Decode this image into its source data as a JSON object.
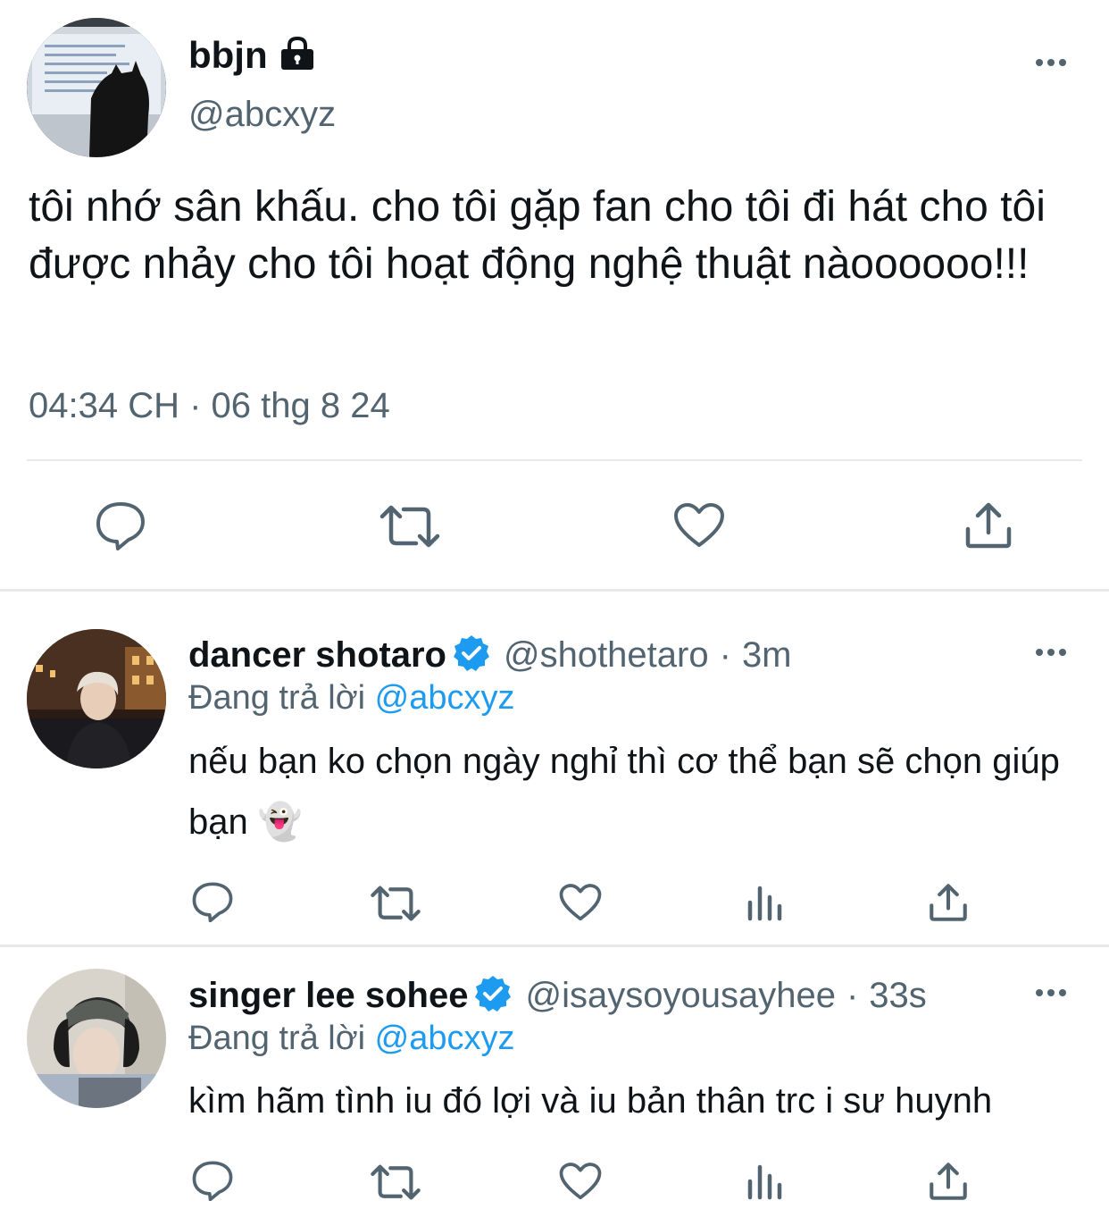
{
  "main_tweet": {
    "author_name": "bbjn",
    "author_handle": "@abcxyz",
    "text": "tôi nhớ sân khấu. cho tôi gặp fan cho tôi đi hát cho tôi được nhảy cho tôi hoạt động nghệ thuật nàoooooo!!!",
    "timestamp": "04:34 CH · 06 thg 8 24",
    "locked": true
  },
  "replies": [
    {
      "author_name": "dancer shotaro",
      "verified": true,
      "author_handle": "@shothetaro",
      "separator": "·",
      "time": "3m",
      "replying_label": "Đang trả lời",
      "replying_to": "@abcxyz",
      "text": "nếu bạn ko chọn ngày nghỉ thì cơ thể bạn sẽ chọn giúp bạn 👻"
    },
    {
      "author_name": "singer lee sohee",
      "verified": true,
      "author_handle": "@isaysoyousayhee",
      "separator": "·",
      "time": "33s",
      "replying_label": "Đang trả lời",
      "replying_to": "@abcxyz",
      "text": "kìm hãm tình iu đó lợi và iu bản thân trc i sư huynh"
    }
  ],
  "icons": {
    "main_actions": [
      "reply-icon",
      "retweet-icon",
      "like-icon",
      "share-icon"
    ],
    "reply_actions": [
      "reply-icon",
      "retweet-icon",
      "like-icon",
      "views-icon",
      "share-icon"
    ],
    "more": "more-options-icon",
    "verified": "verified-badge-icon",
    "lock": "lock-icon"
  },
  "colors": {
    "text": "#0f1419",
    "secondary": "#536471",
    "accent": "#1d9bf0",
    "divider": "#e7e9ea"
  }
}
